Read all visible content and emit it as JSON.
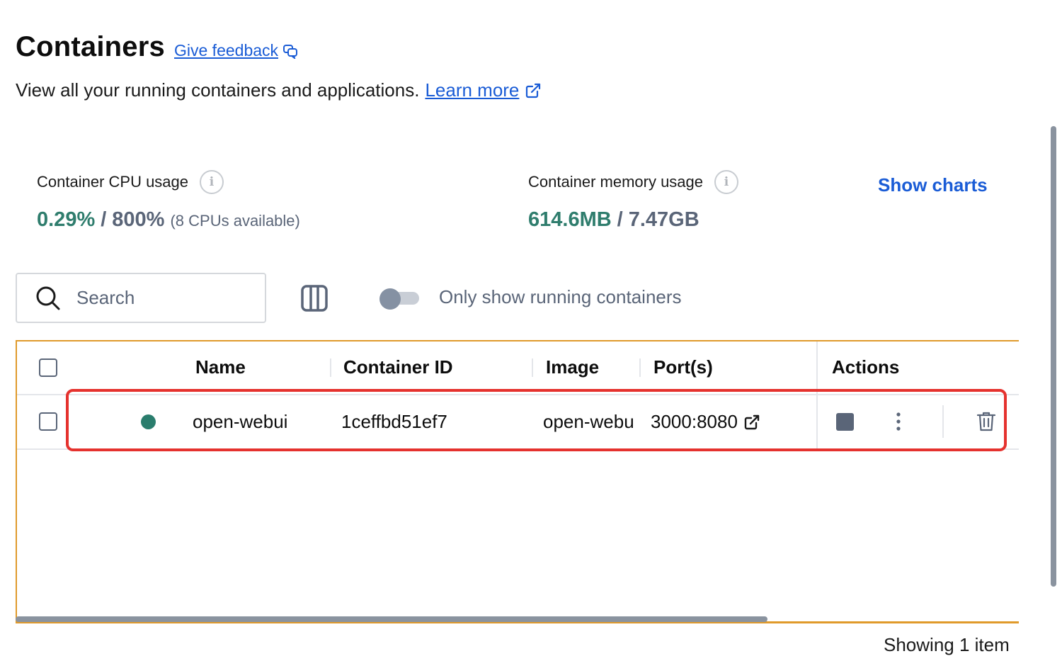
{
  "header": {
    "title": "Containers",
    "feedback_label": "Give feedback",
    "subtitle": "View all your running containers and applications.",
    "learn_more": "Learn more"
  },
  "stats": {
    "cpu": {
      "label": "Container CPU usage",
      "used": "0.29%",
      "separator": "/",
      "total": "800%",
      "available": "(8 CPUs available)"
    },
    "memory": {
      "label": "Container memory usage",
      "used": "614.6MB",
      "separator": "/",
      "total": "7.47GB"
    },
    "info_glyph": "i",
    "show_charts": "Show charts"
  },
  "toolbar": {
    "search_placeholder": "Search",
    "running_toggle_label": "Only show running containers",
    "running_toggle_on": false
  },
  "table": {
    "columns": {
      "name": "Name",
      "container_id": "Container ID",
      "image": "Image",
      "ports": "Port(s)",
      "actions": "Actions"
    },
    "rows": [
      {
        "status": "running",
        "name": "open-webui",
        "container_id": "1ceffbd51ef7",
        "image": "open-webu",
        "ports": "3000:8080",
        "selected": false
      }
    ]
  },
  "footer": {
    "count_text": "Showing 1 item"
  },
  "colors": {
    "link": "#1a5cd6",
    "status_running": "#2a7d6d",
    "usage_green": "#2f7d6d",
    "table_border": "#e09a2b",
    "highlight": "#e5322e"
  }
}
